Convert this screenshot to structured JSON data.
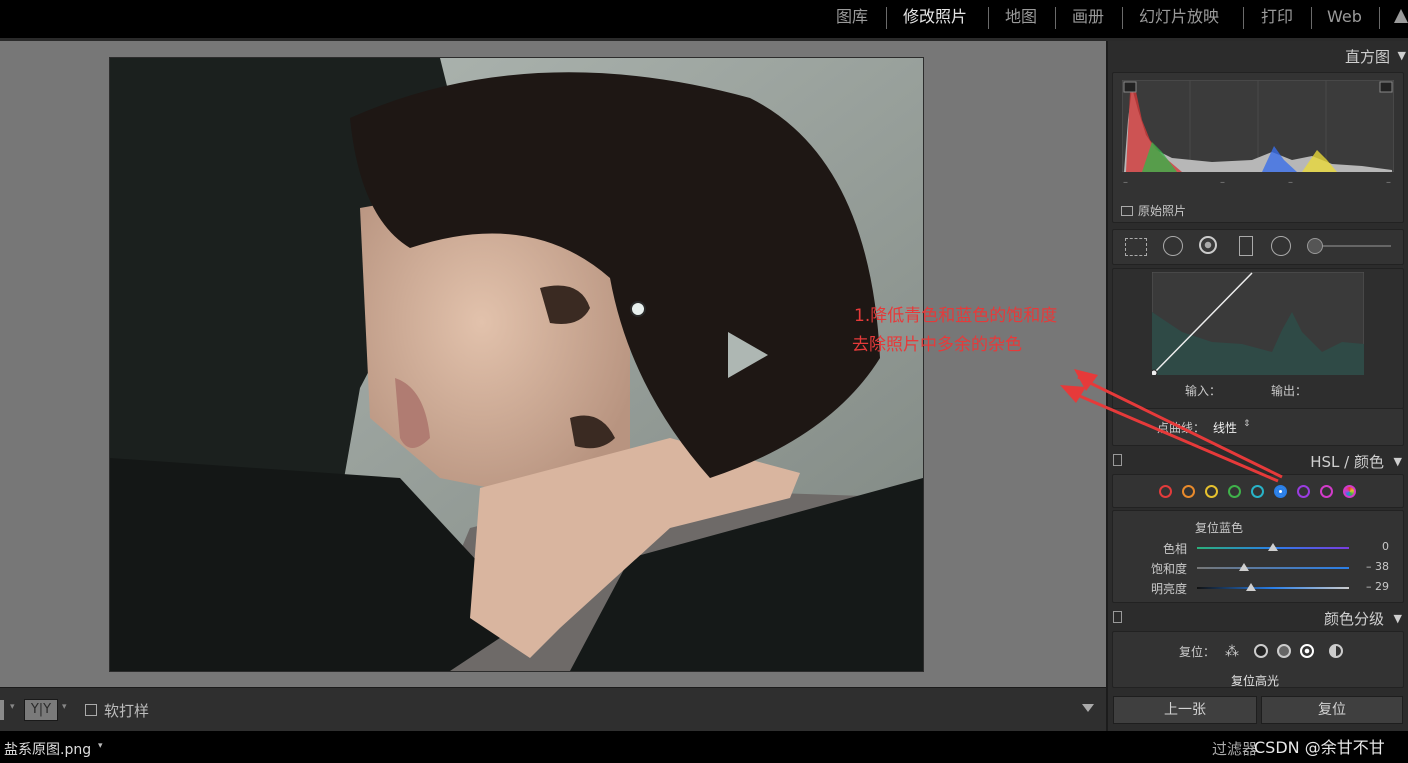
{
  "modules": {
    "items": [
      "图库",
      "修改照片",
      "地图",
      "画册",
      "幻灯片放映",
      "打印",
      "Web"
    ],
    "active": "修改照片"
  },
  "panels": {
    "histogram": {
      "title": "直方图",
      "original_photo_label": "原始照片",
      "readouts": [
        "–",
        "–",
        "–",
        "–"
      ]
    },
    "tone_curve": {
      "input_label": "输入：",
      "output_label": "输出：",
      "point_curve_label": "点曲线：",
      "point_curve_value": "线性"
    },
    "hsl": {
      "title": "HSL / 颜色",
      "swatch_colors": [
        "#e23b3b",
        "#e88a2c",
        "#e6c12e",
        "#3fb24a",
        "#28b3c8",
        "#2a7fe8",
        "#9a3ce0",
        "#d23bc9"
      ],
      "selected_color": "blue",
      "reset_label": "复位蓝色",
      "sliders": [
        {
          "label": "色相",
          "value": "0",
          "level": 0
        },
        {
          "label": "饱和度",
          "value": "– 38",
          "level": -38
        },
        {
          "label": "明亮度",
          "value": "– 29",
          "level": -29
        }
      ]
    },
    "split_toning": {
      "title": "颜色分级",
      "reset_label": "复位：",
      "subtitle": "复位高光"
    }
  },
  "buttons": {
    "previous": "上一张",
    "reset": "复位"
  },
  "toolbar": {
    "yy": "Y|Y",
    "soft_proof": "软打样"
  },
  "filmstrip": {
    "filename": "盐系原图.png",
    "filter_label": "过滤器",
    "watermark": "CSDN @余甘不甘"
  },
  "annotation": {
    "line1": "1.降低青色和蓝色的饱和度",
    "line2": "去除照片中多余的杂色",
    "color": "#e63a3a"
  }
}
